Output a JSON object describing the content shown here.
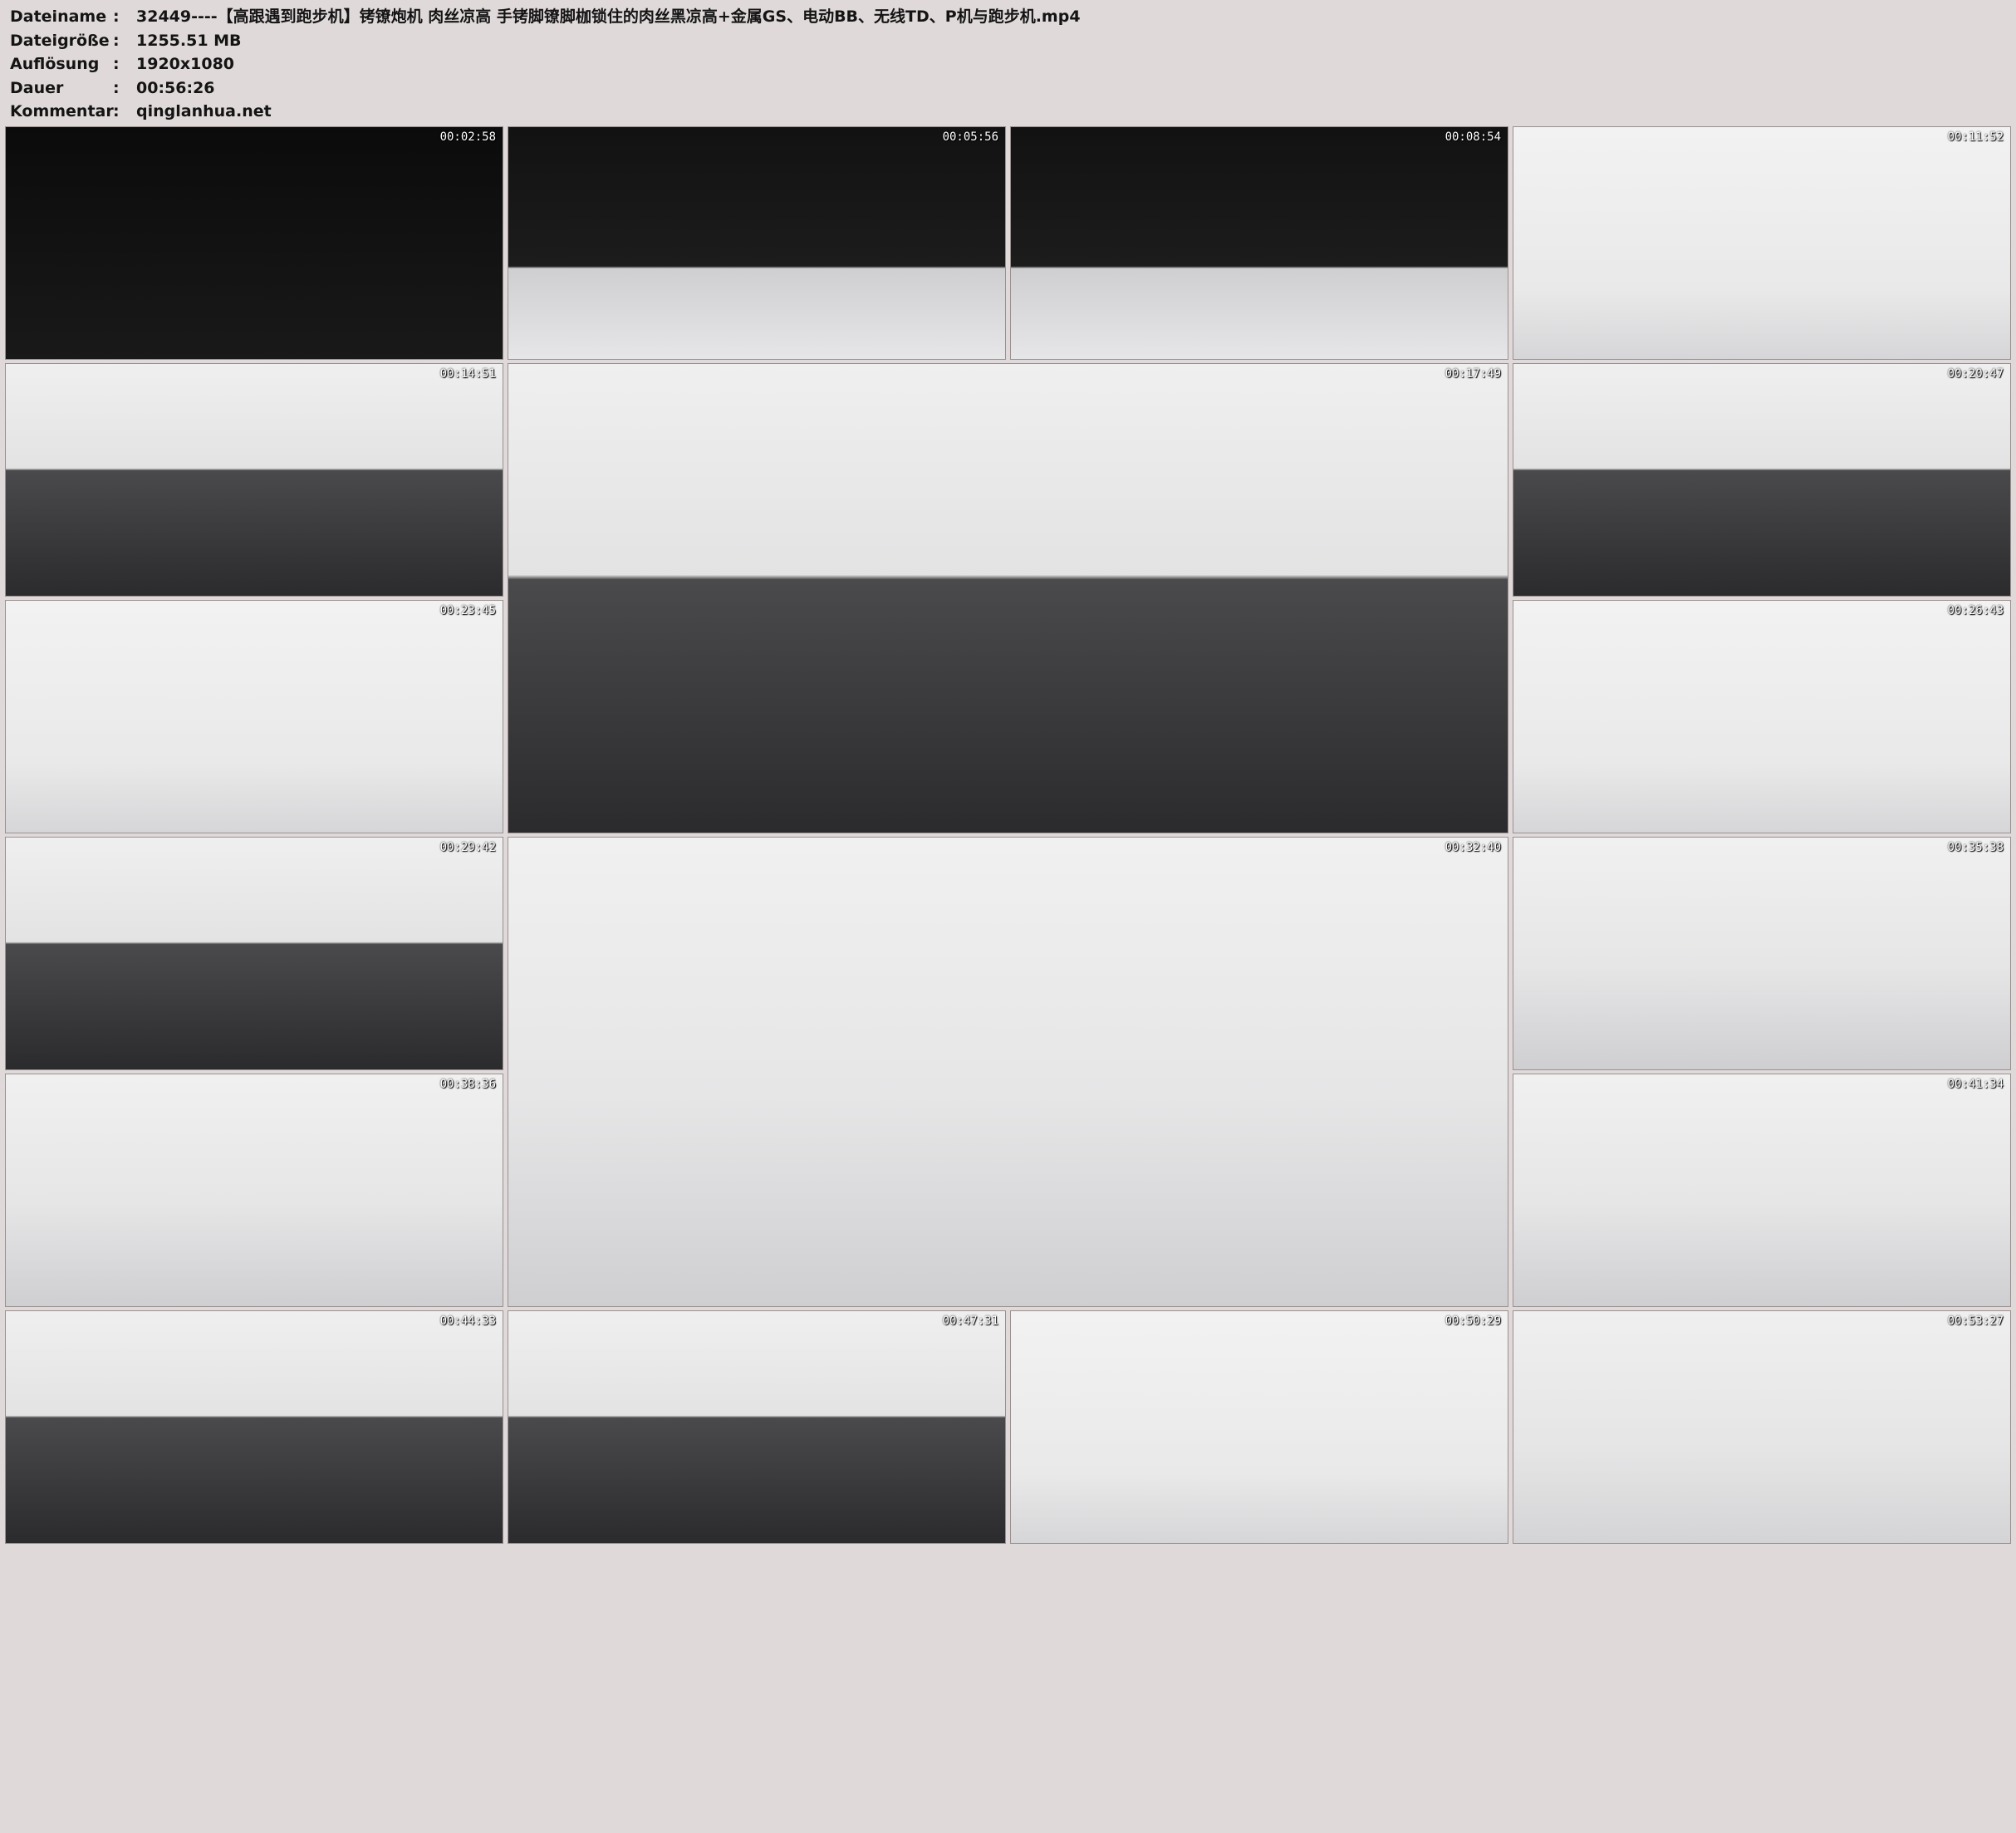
{
  "info": [
    {
      "label": "Dateiname",
      "sep": ":",
      "value": "32449----【高跟遇到跑步机】铐镣炮机 肉丝凉高 手铐脚镣脚枷锁住的肉丝黑凉高+金属GS、电动BB、无线TD、P机与跑步机.mp4"
    },
    {
      "label": "Dateigröße",
      "sep": ":",
      "value": "1255.51 MB"
    },
    {
      "label": "Auflösung",
      "sep": ":",
      "value": "1920x1080"
    },
    {
      "label": "Dauer",
      "sep": ":",
      "value": "00:56:26"
    },
    {
      "label": "Kommentar",
      "sep": ":",
      "value": "qinglanhua.net"
    }
  ],
  "thumbnails": [
    {
      "time": "00:02:58",
      "scene": "dark"
    },
    {
      "time": "00:05:56",
      "scene": "studio"
    },
    {
      "time": "00:08:54",
      "scene": "studio"
    },
    {
      "time": "00:11:52",
      "scene": "room"
    },
    {
      "time": "00:14:51",
      "scene": "tread"
    },
    {
      "time": "00:17:49",
      "scene": "tread"
    },
    {
      "time": "00:20:47",
      "scene": "tread"
    },
    {
      "time": "00:23:45",
      "scene": "room"
    },
    {
      "time": "00:26:43",
      "scene": "room"
    },
    {
      "time": "00:29:42",
      "scene": "tread"
    },
    {
      "time": "00:32:40",
      "scene": "floor"
    },
    {
      "time": "00:35:38",
      "scene": "floor"
    },
    {
      "time": "00:38:36",
      "scene": "floor"
    },
    {
      "time": "00:41:34",
      "scene": "floor"
    },
    {
      "time": "00:44:33",
      "scene": "tread"
    },
    {
      "time": "00:47:31",
      "scene": "tread"
    },
    {
      "time": "00:50:29",
      "scene": "room"
    },
    {
      "time": "00:53:27",
      "scene": "bench"
    }
  ]
}
